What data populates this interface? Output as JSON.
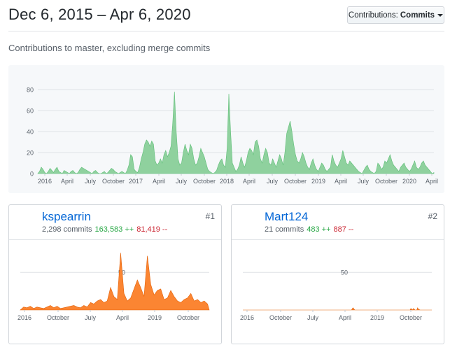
{
  "header": {
    "date_range": "Dec 6, 2015 – Apr 6, 2020",
    "select_prefix": "Contributions:",
    "select_value": "Commits",
    "subtitle": "Contributions to master, excluding merge commits"
  },
  "colors": {
    "main": "#8fd19e",
    "main_stroke": "#5fbf78",
    "contrib": "#fb8532",
    "link": "#0366d6",
    "add": "#28a745",
    "del": "#cb2431"
  },
  "contributors": [
    {
      "rank": "#1",
      "login": "kspearrin",
      "commits": "2,298 commits",
      "additions": "163,583 ++",
      "deletions": "81,419 --",
      "avatar_icon": "photo-avatar"
    },
    {
      "rank": "#2",
      "login": "Mart124",
      "commits": "21 commits",
      "additions": "483 ++",
      "deletions": "887 --",
      "avatar_icon": "identicon-avatar"
    }
  ],
  "chart_data": [
    {
      "type": "area",
      "title": "",
      "x_tick_labels": [
        "2016",
        "April",
        "July",
        "October",
        "2017",
        "April",
        "July",
        "October",
        "2018",
        "April",
        "July",
        "October",
        "2019",
        "April",
        "July",
        "October",
        "2020",
        "April"
      ],
      "y_ticks": [
        0,
        20,
        40,
        60,
        80
      ],
      "ylim": [
        0,
        90
      ],
      "x_range_weeks": [
        0,
        226
      ],
      "grid": true,
      "series": [
        {
          "x_weeks": [
            0,
            1,
            2,
            3,
            4,
            5,
            6,
            7,
            8,
            9,
            10,
            11,
            12,
            13,
            14,
            15,
            16,
            17,
            18,
            19,
            20,
            21,
            22,
            23,
            24,
            25,
            26,
            27,
            28,
            29,
            30,
            31,
            32,
            33,
            34,
            35,
            36,
            37,
            38,
            39,
            40,
            41,
            42,
            43,
            44,
            45,
            46,
            47,
            48,
            49,
            50,
            51,
            52,
            53,
            54,
            55,
            56,
            57,
            58,
            59,
            60,
            61,
            62,
            63,
            64,
            65,
            66,
            67,
            68,
            69,
            70,
            71,
            72,
            73,
            74,
            75,
            76,
            77,
            78,
            79,
            80,
            81,
            82,
            83,
            84,
            85,
            86,
            87,
            88,
            89,
            90,
            91,
            92,
            93,
            94,
            95,
            96,
            97,
            98,
            99,
            100,
            101,
            102,
            103,
            104,
            105,
            106,
            107,
            108,
            109,
            110,
            111,
            112,
            113,
            114,
            115,
            116,
            117,
            118,
            119,
            120,
            121,
            122,
            123,
            124,
            125,
            126,
            127,
            128,
            129,
            130,
            131,
            132,
            133,
            134,
            135,
            136,
            137,
            138,
            139,
            140,
            141,
            142,
            143,
            144,
            145,
            146,
            147,
            148,
            149,
            150,
            151,
            152,
            153,
            154,
            155,
            156,
            157,
            158,
            159,
            160,
            161,
            162,
            163,
            164,
            165,
            166,
            167,
            168,
            169,
            170,
            171,
            172,
            173,
            174,
            175,
            176,
            177,
            178,
            179,
            180,
            181,
            182,
            183,
            184,
            185,
            186,
            187,
            188,
            189,
            190,
            191,
            192,
            193,
            194,
            195,
            196,
            197,
            198,
            199,
            200,
            201,
            202,
            203,
            204,
            205,
            206,
            207,
            208,
            209,
            210,
            211,
            212,
            213,
            214,
            215,
            216,
            217,
            218,
            219,
            220,
            221,
            222,
            223,
            224,
            225,
            226
          ],
          "values": [
            0,
            2,
            6,
            4,
            1,
            0,
            2,
            5,
            3,
            1,
            4,
            6,
            2,
            1,
            0,
            3,
            2,
            1,
            0,
            2,
            3,
            1,
            0,
            1,
            4,
            6,
            5,
            4,
            3,
            2,
            1,
            0,
            2,
            3,
            1,
            0,
            0,
            1,
            2,
            0,
            1,
            3,
            5,
            4,
            2,
            1,
            0,
            1,
            2,
            1,
            0,
            3,
            8,
            18,
            16,
            4,
            2,
            1,
            6,
            14,
            20,
            28,
            32,
            30,
            26,
            31,
            28,
            12,
            8,
            10,
            14,
            10,
            18,
            22,
            16,
            20,
            26,
            48,
            78,
            40,
            14,
            8,
            10,
            20,
            28,
            22,
            18,
            28,
            24,
            14,
            8,
            10,
            16,
            24,
            20,
            16,
            10,
            4,
            2,
            1,
            0,
            1,
            3,
            8,
            12,
            14,
            8,
            6,
            24,
            76,
            40,
            10,
            6,
            2,
            4,
            8,
            16,
            10,
            6,
            12,
            20,
            24,
            22,
            18,
            30,
            32,
            26,
            14,
            10,
            18,
            24,
            20,
            10,
            8,
            14,
            10,
            6,
            12,
            18,
            14,
            8,
            20,
            38,
            44,
            50,
            40,
            28,
            18,
            12,
            10,
            14,
            20,
            16,
            10,
            6,
            4,
            10,
            14,
            8,
            4,
            2,
            6,
            10,
            8,
            4,
            2,
            4,
            6,
            18,
            12,
            8,
            6,
            10,
            14,
            22,
            16,
            10,
            8,
            12,
            10,
            8,
            6,
            4,
            2,
            1,
            0,
            3,
            6,
            8,
            4,
            2,
            1,
            0,
            2,
            10,
            8,
            4,
            6,
            12,
            10,
            14,
            18,
            12,
            8,
            6,
            4,
            2,
            6,
            8,
            10,
            6,
            4,
            2,
            4,
            8,
            12,
            6,
            4,
            6,
            10,
            12,
            8,
            6,
            4,
            2,
            0,
            1,
            8,
            10,
            6,
            0
          ]
        }
      ]
    },
    {
      "type": "area",
      "title": "",
      "x_tick_labels": [
        "2016",
        "October",
        "July",
        "April",
        "2019",
        "October"
      ],
      "y_ticks": [
        50
      ],
      "ylim": [
        0,
        80
      ],
      "x_range_weeks": [
        0,
        226
      ],
      "grid": true,
      "series": [
        {
          "name": "kspearrin",
          "x_weeks": [
            0,
            4,
            8,
            12,
            16,
            20,
            24,
            28,
            32,
            36,
            40,
            44,
            48,
            52,
            56,
            60,
            64,
            68,
            72,
            76,
            80,
            84,
            88,
            92,
            96,
            100,
            104,
            108,
            112,
            116,
            120,
            124,
            128,
            132,
            136,
            140,
            144,
            148,
            152,
            156,
            160,
            164,
            168,
            172,
            176,
            180,
            184,
            188,
            192,
            196,
            200,
            204,
            208,
            212,
            216,
            220,
            224,
            226
          ],
          "values": [
            0,
            4,
            3,
            5,
            2,
            4,
            3,
            2,
            4,
            6,
            3,
            5,
            2,
            3,
            4,
            5,
            6,
            4,
            3,
            6,
            4,
            10,
            8,
            12,
            14,
            10,
            12,
            30,
            18,
            14,
            76,
            22,
            12,
            16,
            28,
            40,
            30,
            18,
            72,
            34,
            20,
            26,
            28,
            14,
            16,
            26,
            18,
            12,
            10,
            14,
            16,
            22,
            12,
            14,
            10,
            12,
            8,
            0
          ]
        }
      ]
    },
    {
      "type": "area",
      "title": "",
      "x_tick_labels": [
        "2016",
        "October",
        "July",
        "April",
        "2019",
        "October"
      ],
      "y_ticks": [
        50
      ],
      "ylim": [
        0,
        80
      ],
      "x_range_weeks": [
        0,
        226
      ],
      "grid": true,
      "series": [
        {
          "name": "Mart124",
          "x_weeks": [
            0,
            40,
            80,
            120,
            130,
            131,
            132,
            133,
            134,
            150,
            170,
            190,
            200,
            201,
            202,
            203,
            204,
            206,
            208,
            209,
            210,
            212,
            226
          ],
          "values": [
            0,
            0,
            0,
            0,
            0,
            2,
            3,
            1,
            0,
            0,
            0,
            0,
            0,
            2,
            1,
            0,
            2,
            0,
            0,
            3,
            1,
            0,
            0
          ]
        }
      ]
    }
  ]
}
